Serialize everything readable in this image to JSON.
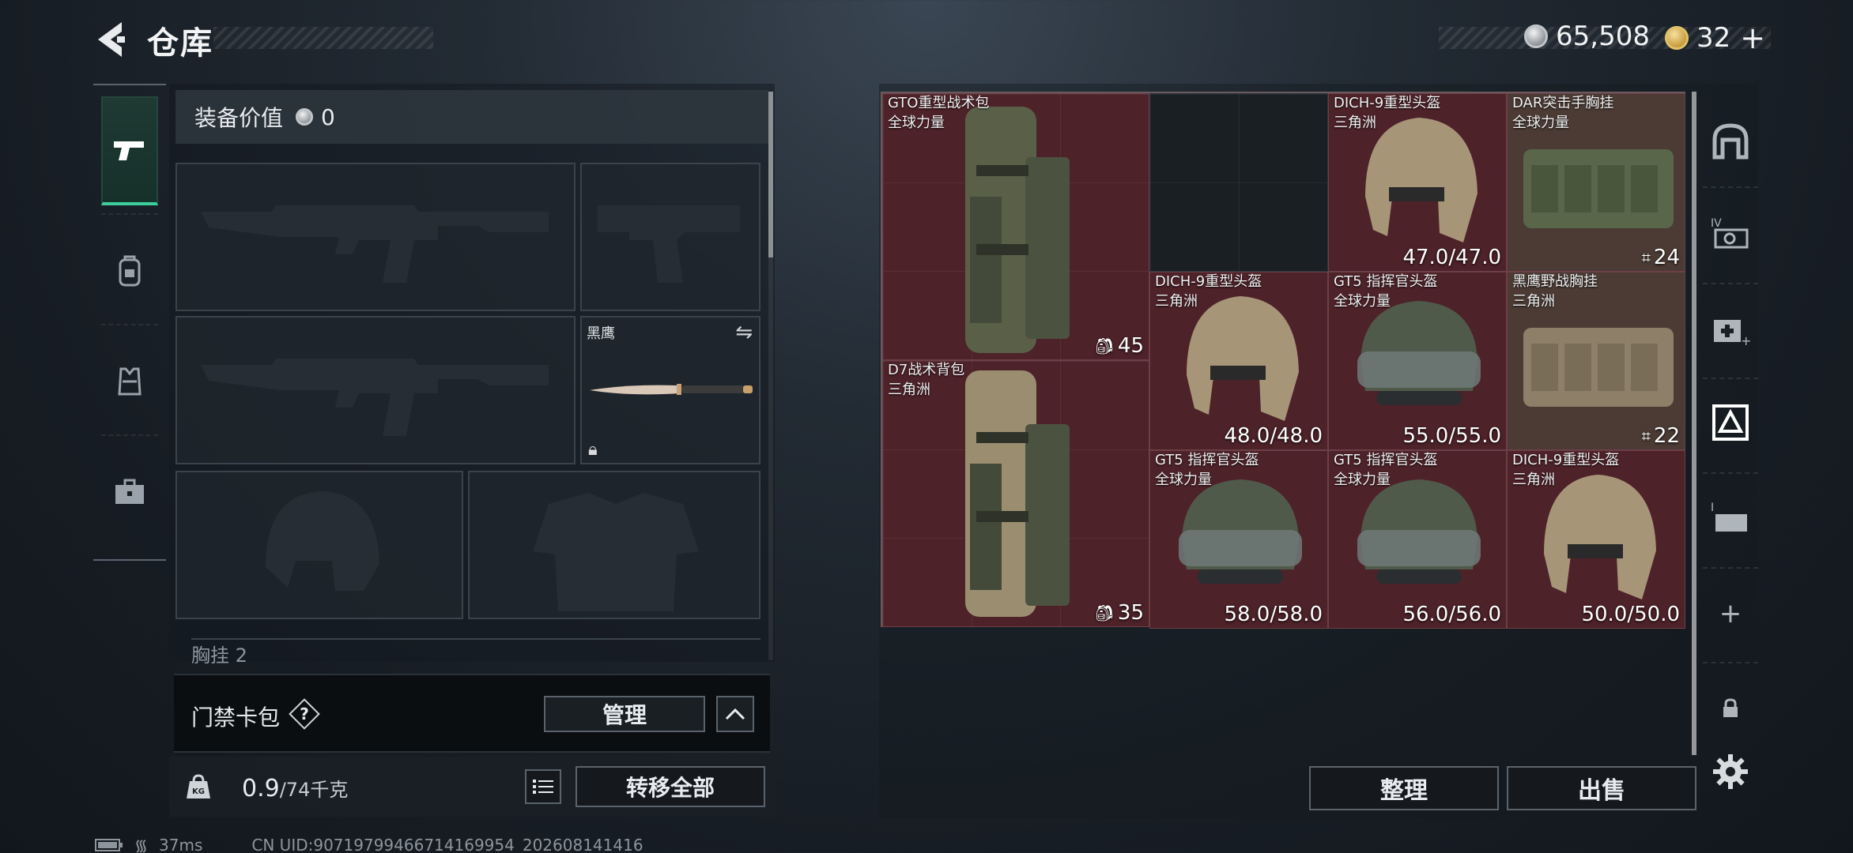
{
  "header": {
    "title": "仓库",
    "currencies": [
      {
        "icon": "silver-coin-icon",
        "value": "65,508"
      },
      {
        "icon": "gold-coin-icon",
        "value": "32",
        "suffix": "+"
      }
    ]
  },
  "categories": [
    {
      "name": "weapons",
      "icon": "pistol-icon",
      "active": true
    },
    {
      "name": "armor",
      "icon": "backpack-icon",
      "active": false
    },
    {
      "name": "vest",
      "icon": "vest-icon",
      "active": false
    },
    {
      "name": "toolbox",
      "icon": "briefcase-icon",
      "active": false
    }
  ],
  "loadout": {
    "value_label": "装备价值",
    "value": "0",
    "melee_name": "黑鹰",
    "chest_label": "胸挂 2"
  },
  "keycard": {
    "label": "门禁卡包",
    "help": "?",
    "manage_label": "管理"
  },
  "weight": {
    "current": "0.9",
    "max": "/74千克",
    "transfer_label": "转移全部"
  },
  "storage": {
    "items": [
      {
        "name": "GTO重型战术包",
        "origin": "全球力量",
        "stat": "45",
        "stat_type": "capacity"
      },
      {
        "name": "D7战术背包",
        "origin": "三角洲",
        "stat": "35",
        "stat_type": "capacity"
      },
      {
        "name": "DICH-9重型头盔",
        "origin": "三角洲",
        "stat": "47.0/47.0",
        "stat_type": "durability"
      },
      {
        "name": "DAR突击手胸挂",
        "origin": "全球力量",
        "stat": "24",
        "stat_type": "slots"
      },
      {
        "name": "DICH-9重型头盔",
        "origin": "三角洲",
        "stat": "48.0/48.0",
        "stat_type": "durability"
      },
      {
        "name": "GT5 指挥官头盔",
        "origin": "全球力量",
        "stat": "55.0/55.0",
        "stat_type": "durability"
      },
      {
        "name": "黑鹰野战胸挂",
        "origin": "三角洲",
        "stat": "22",
        "stat_type": "slots"
      },
      {
        "name": "GT5 指挥官头盔",
        "origin": "全球力量",
        "stat": "58.0/58.0",
        "stat_type": "durability"
      },
      {
        "name": "GT5 指挥官头盔",
        "origin": "全球力量",
        "stat": "56.0/56.0",
        "stat_type": "durability"
      },
      {
        "name": "DICH-9重型头盔",
        "origin": "三角洲",
        "stat": "50.0/50.0",
        "stat_type": "durability"
      }
    ],
    "sort_label": "整理",
    "sell_label": "出售"
  },
  "side_toolbar": [
    "storage-icon",
    "tier-iv-icon",
    "medkit-add-icon",
    "exchange-icon",
    "tier-i-icon",
    "add-icon",
    "lock-icon",
    "settings-icon"
  ],
  "status_bar": {
    "ping": "37ms",
    "uid": "CN UID:90719799466714169954_202608141416"
  },
  "colors": {
    "accent_green": "#3ccf9c",
    "item_red_bg": "#4e2229",
    "panel_bg": "#1a1f24"
  }
}
